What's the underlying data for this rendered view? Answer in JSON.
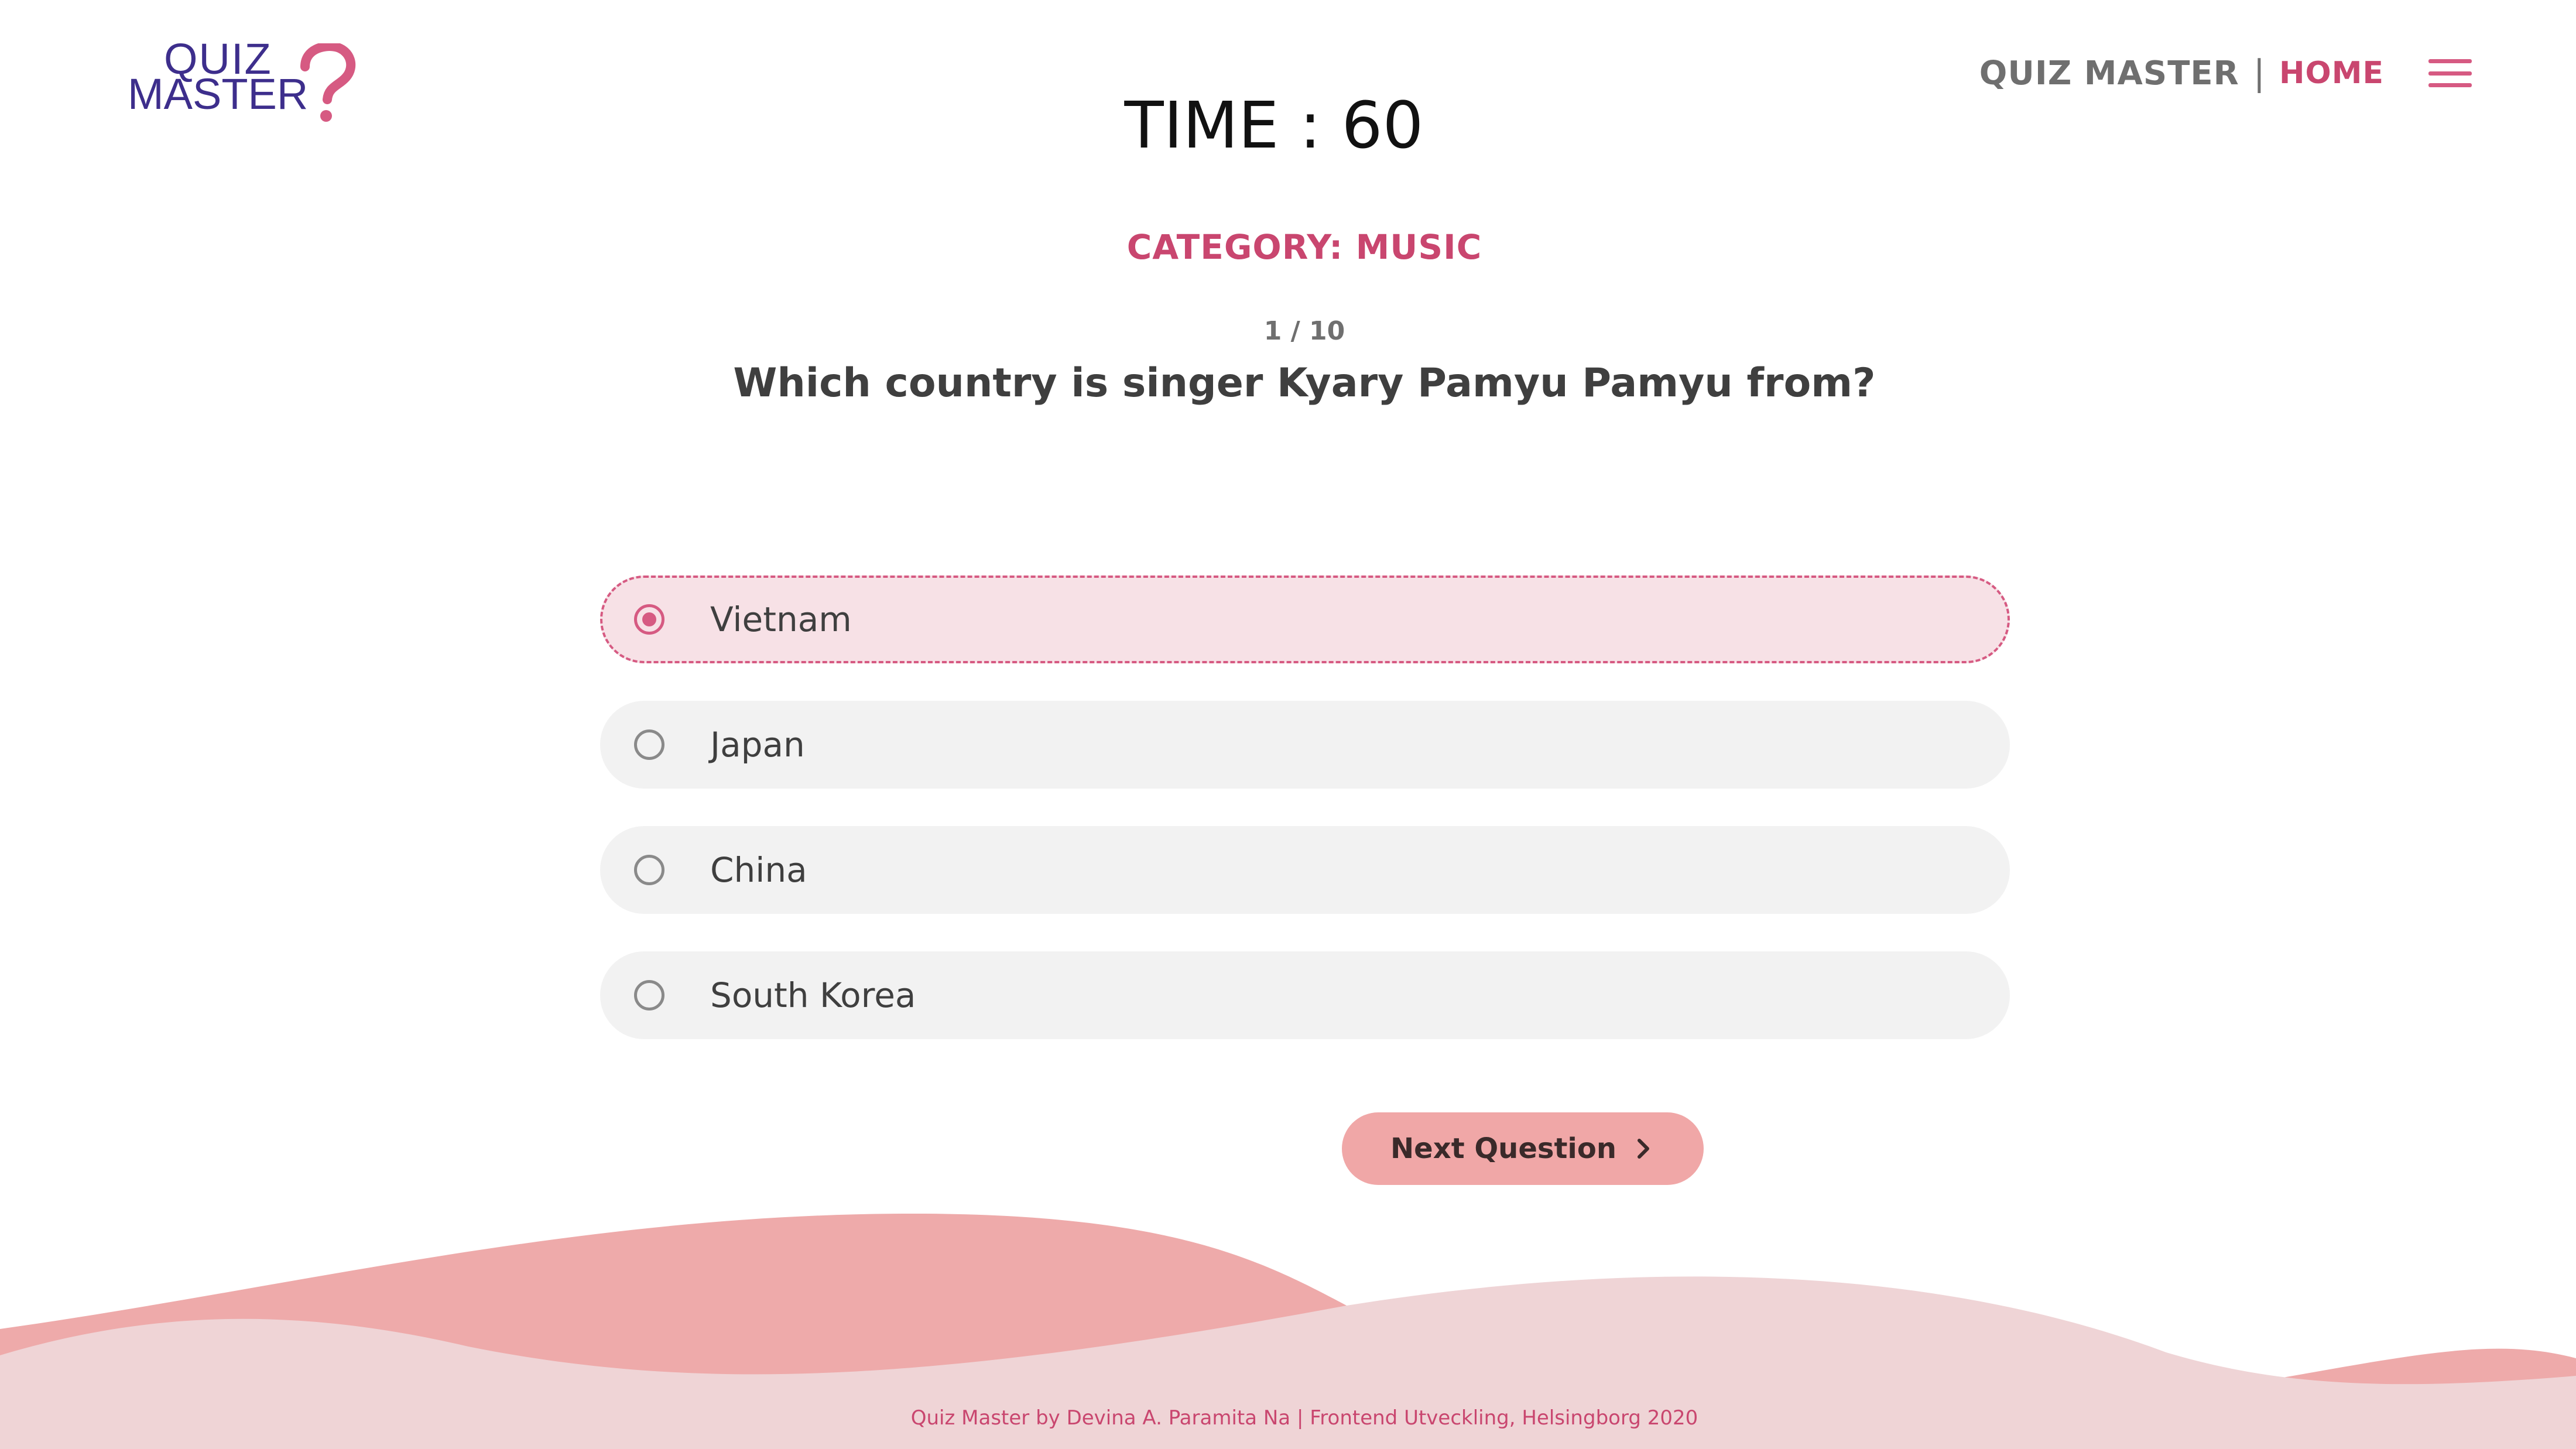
{
  "logo": {
    "line1": "QUIZ",
    "line2": "MASTER",
    "brand_color": "#3d2e8c",
    "accent_color": "#d65a82",
    "icon": "question-mark-icon"
  },
  "nav": {
    "site_name": "QUIZ MASTER",
    "separator": "|",
    "home": "HOME",
    "menu_icon": "hamburger-menu-icon"
  },
  "timer": {
    "text": "TIME : 60"
  },
  "quiz": {
    "category": "CATEGORY: MUSIC",
    "counter": "1 / 10",
    "question": "Which country is singer Kyary Pamyu Pamyu from?",
    "options": [
      {
        "label": "Vietnam",
        "selected": true
      },
      {
        "label": "Japan",
        "selected": false
      },
      {
        "label": "China",
        "selected": false
      },
      {
        "label": "South Korea",
        "selected": false
      }
    ],
    "next_button": "Next Question",
    "next_icon": "chevron-right-icon"
  },
  "footer": {
    "text": "Quiz Master by Devina A. Paramita Na | Frontend Utveckling, Helsingborg 2020"
  },
  "colors": {
    "accent": "#c9466f",
    "selected_bg": "#f7e1e6",
    "option_bg": "#f2f2f2",
    "button_bg": "#f0a7a7",
    "wave_dark": "#eeaaaa",
    "wave_light": "#efd4d6"
  }
}
